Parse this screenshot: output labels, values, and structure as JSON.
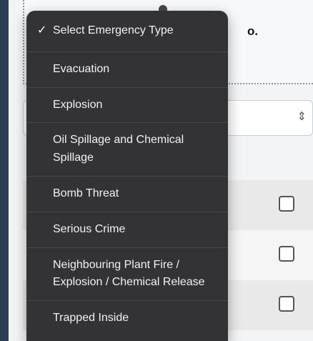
{
  "background_text": {
    "top_fragment": "o."
  },
  "select": {
    "caret_icon": "up-down-caret-icon"
  },
  "dropdown": {
    "selected_label": "Select Emergency Type",
    "options": [
      "Evacuation",
      "Explosion",
      "Oil Spillage and Chemical Spillage",
      "Bomb Threat",
      "Serious Crime",
      "Neighbouring Plant Fire / Explosion / Chemical Release",
      "Trapped Inside"
    ]
  },
  "colors": {
    "menu_background": "#333336",
    "menu_text": "#f2f2f2",
    "page_background": "#f3f4f6",
    "checkbox_border": "#555555"
  }
}
